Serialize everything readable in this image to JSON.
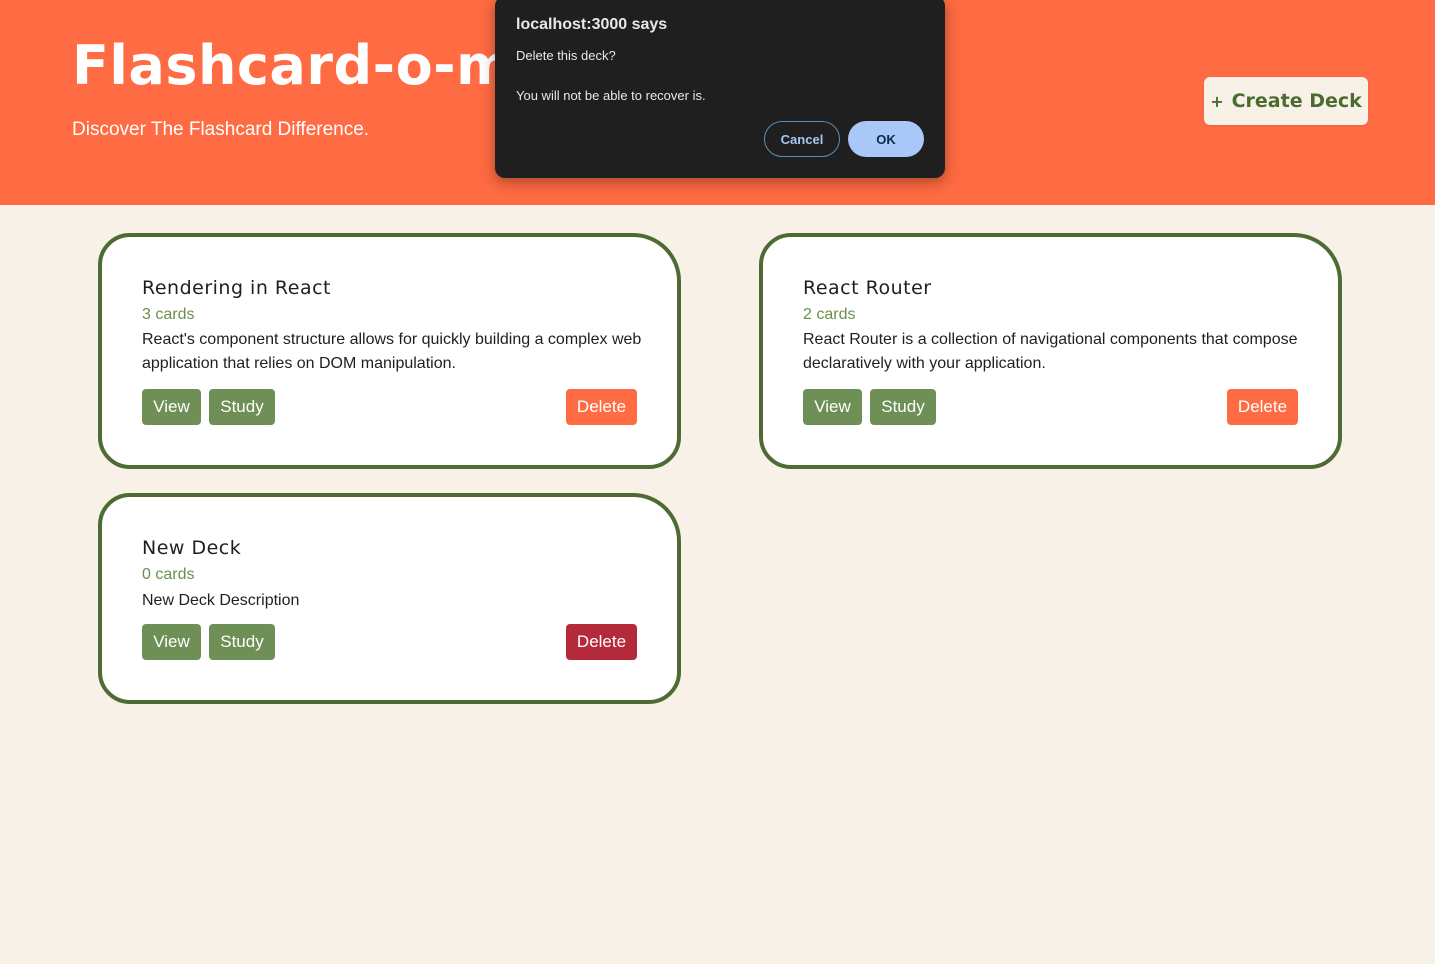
{
  "header": {
    "title": "Flashcard-o-matic",
    "subtitle": "Discover The Flashcard Difference.",
    "create_deck_label": "Create Deck",
    "create_deck_icon": "plus-icon",
    "create_deck_plus": "+"
  },
  "decks": [
    {
      "name": "Rendering in React",
      "count": "3 cards",
      "description": "React's component structure allows for quickly building a complex web application that relies on DOM manipulation.",
      "view_label": "View",
      "study_label": "Study",
      "delete_label": "Delete"
    },
    {
      "name": "React Router",
      "count": "2 cards",
      "description": "React Router is a collection of navigational components that compose declaratively with your application.",
      "view_label": "View",
      "study_label": "Study",
      "delete_label": "Delete"
    },
    {
      "name": "New Deck",
      "count": "0 cards",
      "description": "New Deck Description",
      "view_label": "View",
      "study_label": "Study",
      "delete_label": "Delete"
    }
  ],
  "dialog": {
    "origin": "localhost:3000 says",
    "message_line1": "Delete this deck?",
    "message_line2": "You will not be able to recover is.",
    "cancel_label": "Cancel",
    "ok_label": "OK"
  },
  "colors": {
    "header_bg": "#ff6b42",
    "page_bg": "#f8f1e8",
    "accent_green": "#6e8f56",
    "card_border": "#4f6b34",
    "delete_orange": "#ff6b42",
    "delete_hover_red": "#b52a3a",
    "dialog_bg": "#1f1f1f"
  }
}
